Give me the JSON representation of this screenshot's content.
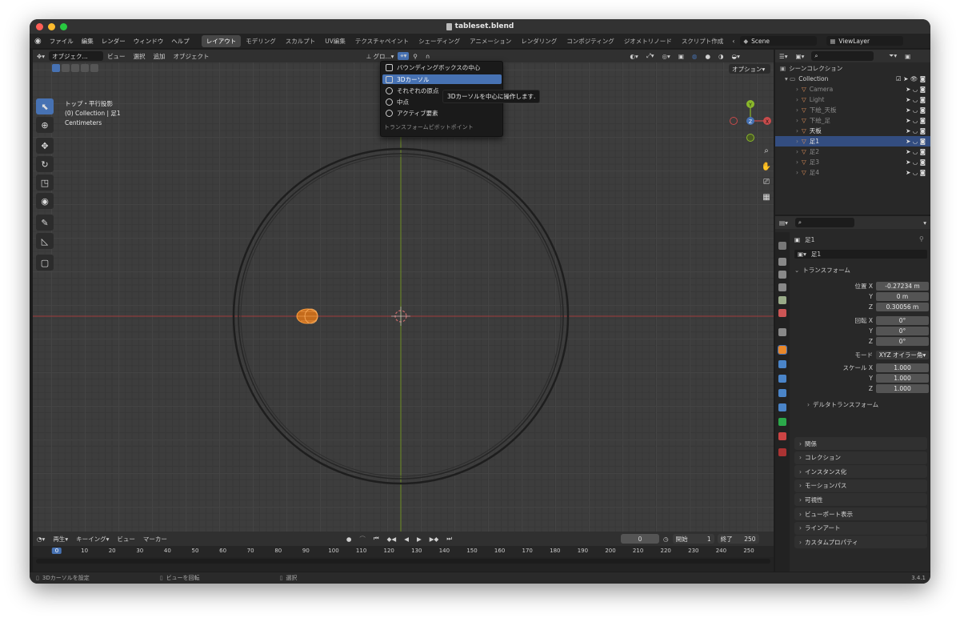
{
  "window": {
    "title": "tableset.blend"
  },
  "menu": [
    "ファイル",
    "編集",
    "レンダー",
    "ウィンドウ",
    "ヘルプ"
  ],
  "workspaces": [
    "レイアウト",
    "モデリング",
    "スカルプト",
    "UV編集",
    "テクスチャペイント",
    "シェーディング",
    "アニメーション",
    "レンダリング",
    "コンポジティング",
    "ジオメトリノード",
    "スクリプト作成"
  ],
  "scene": "Scene",
  "view_layer": "ViewLayer",
  "viewport_header": {
    "mode": "オブジェク...",
    "view": "ビュー",
    "select": "選択",
    "add": "追加",
    "object": "オブジェクト",
    "orientation": "グロ...",
    "options": "オプション"
  },
  "viewport_info": {
    "view_name": "トップ・平行投影",
    "collection": "(0) Collection | 足1",
    "units": "Centimeters"
  },
  "pivot_menu": {
    "items": [
      {
        "label": "バウンディングボックスの中心",
        "icon": "bounding-box-icon"
      },
      {
        "label": "3Dカーソル",
        "icon": "cursor-icon",
        "selected": true
      },
      {
        "label": "それぞれの原点",
        "icon": "individual-origins-icon"
      },
      {
        "label": "中点",
        "icon": "median-point-icon"
      },
      {
        "label": "アクティブ要素",
        "icon": "active-element-icon"
      }
    ],
    "title": "トランスフォームピボットポイント",
    "tooltip": "3Dカーソルを中心に操作します."
  },
  "gizmo": {
    "y": "Y",
    "z": "Z",
    "x": "X"
  },
  "timeline": {
    "play": "再生",
    "keying": "キーイング",
    "view": "ビュー",
    "marker": "マーカー",
    "current_frame": "0",
    "start_label": "開始",
    "start": "1",
    "end_label": "終了",
    "end": "250",
    "ruler": [
      "0",
      "10",
      "20",
      "30",
      "40",
      "50",
      "60",
      "70",
      "80",
      "90",
      "100",
      "110",
      "120",
      "130",
      "140",
      "150",
      "160",
      "170",
      "180",
      "190",
      "200",
      "210",
      "220",
      "230",
      "240",
      "250"
    ]
  },
  "status": {
    "left": "3Dカーソルを設定",
    "middle": "ビューを回転",
    "right": "選択",
    "version": "3.4.1"
  },
  "outliner": {
    "scene_collection": "シーンコレクション",
    "collection": "Collection",
    "items": [
      {
        "name": "Camera",
        "color": "#e0915a",
        "dim": true
      },
      {
        "name": "Light",
        "color": "#e0915a",
        "dim": true
      },
      {
        "name": "下絵_天板",
        "color": "#e0915a",
        "dim": true
      },
      {
        "name": "下絵_足",
        "color": "#e0915a",
        "dim": true
      },
      {
        "name": "天板",
        "color": "#e0915a",
        "dim": false
      },
      {
        "name": "足1",
        "color": "#e0915a",
        "dim": false,
        "selected": true
      },
      {
        "name": "足2",
        "color": "#e0915a",
        "dim": true
      },
      {
        "name": "足3",
        "color": "#e0915a",
        "dim": true
      },
      {
        "name": "足4",
        "color": "#e0915a",
        "dim": true
      }
    ]
  },
  "properties": {
    "object_name": "足1",
    "data_name": "足1",
    "transform_label": "トランスフォーム",
    "location_label": "位置 X",
    "location": [
      "-0.27234 m",
      "0 m",
      "0.30056 m"
    ],
    "rotation_label": "回転 X",
    "rotation": [
      "0°",
      "0°",
      "0°"
    ],
    "mode_label": "モード",
    "mode": "XYZ オイラー角",
    "scale_label": "スケール X",
    "scale": [
      "1.000",
      "1.000",
      "1.000"
    ],
    "y_label": "Y",
    "z_label": "Z",
    "delta": "デルタトランスフォーム",
    "panels": [
      "関係",
      "コレクション",
      "インスタンス化",
      "モーションパス",
      "可視性",
      "ビューポート表示",
      "ラインアート",
      "カスタムプロパティ"
    ]
  },
  "colors": {
    "accent": "#4772b3",
    "object": "#e8872a",
    "x_axis": "#c84b4b",
    "y_axis": "#8ab82b"
  }
}
